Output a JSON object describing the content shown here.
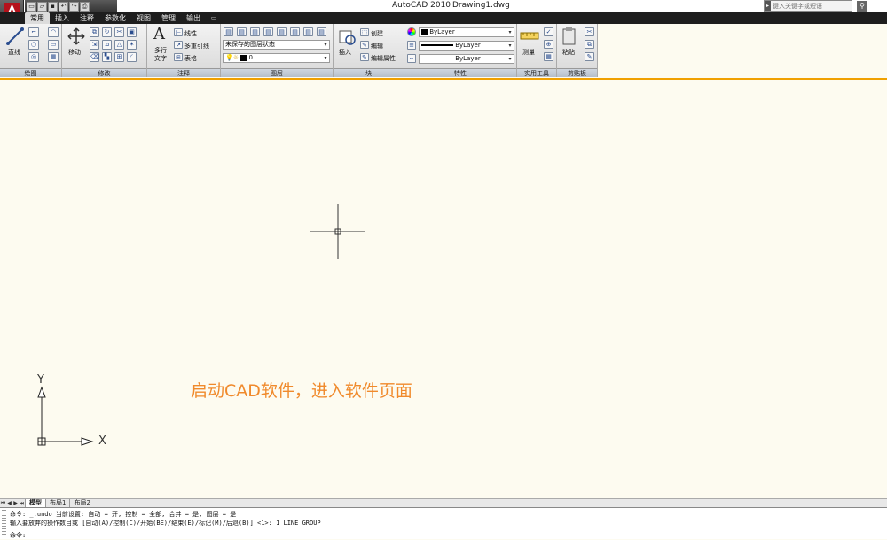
{
  "title": {
    "app": "AutoCAD 2010",
    "doc": "Drawing1.dwg"
  },
  "search": {
    "placeholder": "键入关键字或短语"
  },
  "tabs": [
    "常用",
    "插入",
    "注释",
    "参数化",
    "视图",
    "管理",
    "输出"
  ],
  "tab_extra": "▭",
  "panels": {
    "draw": {
      "title": "绘图",
      "line": "直线"
    },
    "modify": {
      "title": "修改",
      "move": "移动"
    },
    "annot": {
      "title": "注释",
      "mtext": "多行",
      "mtext2": "文字",
      "linear": "线性",
      "mleader": "多重引线",
      "table": "表格",
      "big_a": "A"
    },
    "layers": {
      "title": "图层",
      "state": "未保存的图层状态",
      "layer": "0"
    },
    "block": {
      "title": "块",
      "insert": "插入",
      "create": "创建",
      "edit": "编辑",
      "attr": "编辑属性"
    },
    "props": {
      "title": "特性",
      "color": "ByLayer",
      "linetype": "ByLayer",
      "lineweight": "ByLayer"
    },
    "utils": {
      "title": "实用工具",
      "measure": "测量"
    },
    "clip": {
      "title": "剪贴板",
      "paste": "粘贴"
    }
  },
  "ucs": {
    "x": "X",
    "y": "Y"
  },
  "caption": "启动CAD软件，进入软件页面",
  "layout_tabs": [
    "模型",
    "布局1",
    "布局2"
  ],
  "command": {
    "line1": "命令:  _.undo 当前设置: 自动 = 开, 控制 = 全部, 合并 = 是, 图层 = 是",
    "line2": "输入要放弃的操作数目或 [自动(A)/控制(C)/开始(BE)/结束(E)/标记(M)/后退(B)] <1>: 1 LINE GROUP",
    "prompt": "命令:"
  },
  "colors": {
    "accent": "#f08a2c",
    "canvas": "#fdfbf0",
    "tabbar": "#1e1e1e"
  },
  "icons": [
    "autocad-logo-icon",
    "new-icon",
    "open-icon",
    "save-icon",
    "undo-icon",
    "redo-icon",
    "plot-icon",
    "search-icon",
    "move-icon",
    "crosshair-icon"
  ]
}
